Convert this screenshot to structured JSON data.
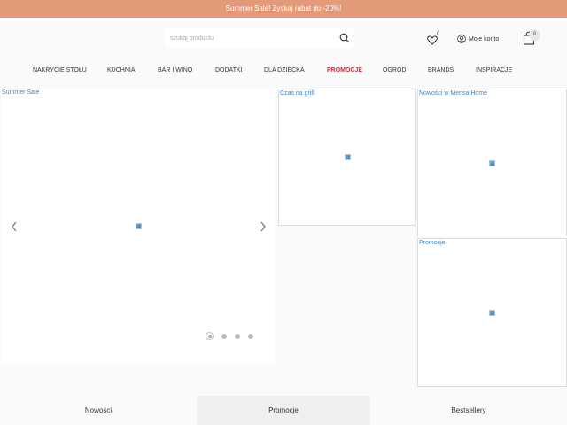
{
  "promo_bar": {
    "text": "Summer Sale! Zyskaj rabat do -20%!"
  },
  "header": {
    "search": {
      "placeholder": "szukaj produktu",
      "icon": "search-icon"
    },
    "wishlist": {
      "icon": "heart-icon",
      "count": "0"
    },
    "account": {
      "icon": "user-icon",
      "label": "Moje konto"
    },
    "cart": {
      "icon": "bag-icon",
      "count": "0"
    }
  },
  "nav": {
    "items": [
      {
        "label": "NAKRYCIE STOŁU"
      },
      {
        "label": "KUCHNIA"
      },
      {
        "label": "BAR I WINO"
      },
      {
        "label": "DODATKI"
      },
      {
        "label": "DLA DZIECKA"
      },
      {
        "label": "PROMOCJE",
        "highlight": true,
        "color": "#c0343f"
      },
      {
        "label": "OGRÓD"
      },
      {
        "label": "BRANDS"
      },
      {
        "label": "INSPIRACJE"
      }
    ]
  },
  "banners": {
    "main": {
      "alt": "Summer Sale"
    },
    "grill": {
      "alt": "Czas na grill"
    },
    "new": {
      "alt": "Nowości w Mensa Home"
    },
    "promo": {
      "alt": "Promocje"
    }
  },
  "slider": {
    "slide_count": 4,
    "active_index": 0
  },
  "tabs": [
    {
      "label": "Nowości",
      "active": false
    },
    {
      "label": "Promocje",
      "active": true
    },
    {
      "label": "Bestsellery",
      "active": false
    }
  ],
  "colors": {
    "promo_bar": "#e29a79",
    "link": "#3a87c9",
    "promo_nav": "#c0343f"
  }
}
